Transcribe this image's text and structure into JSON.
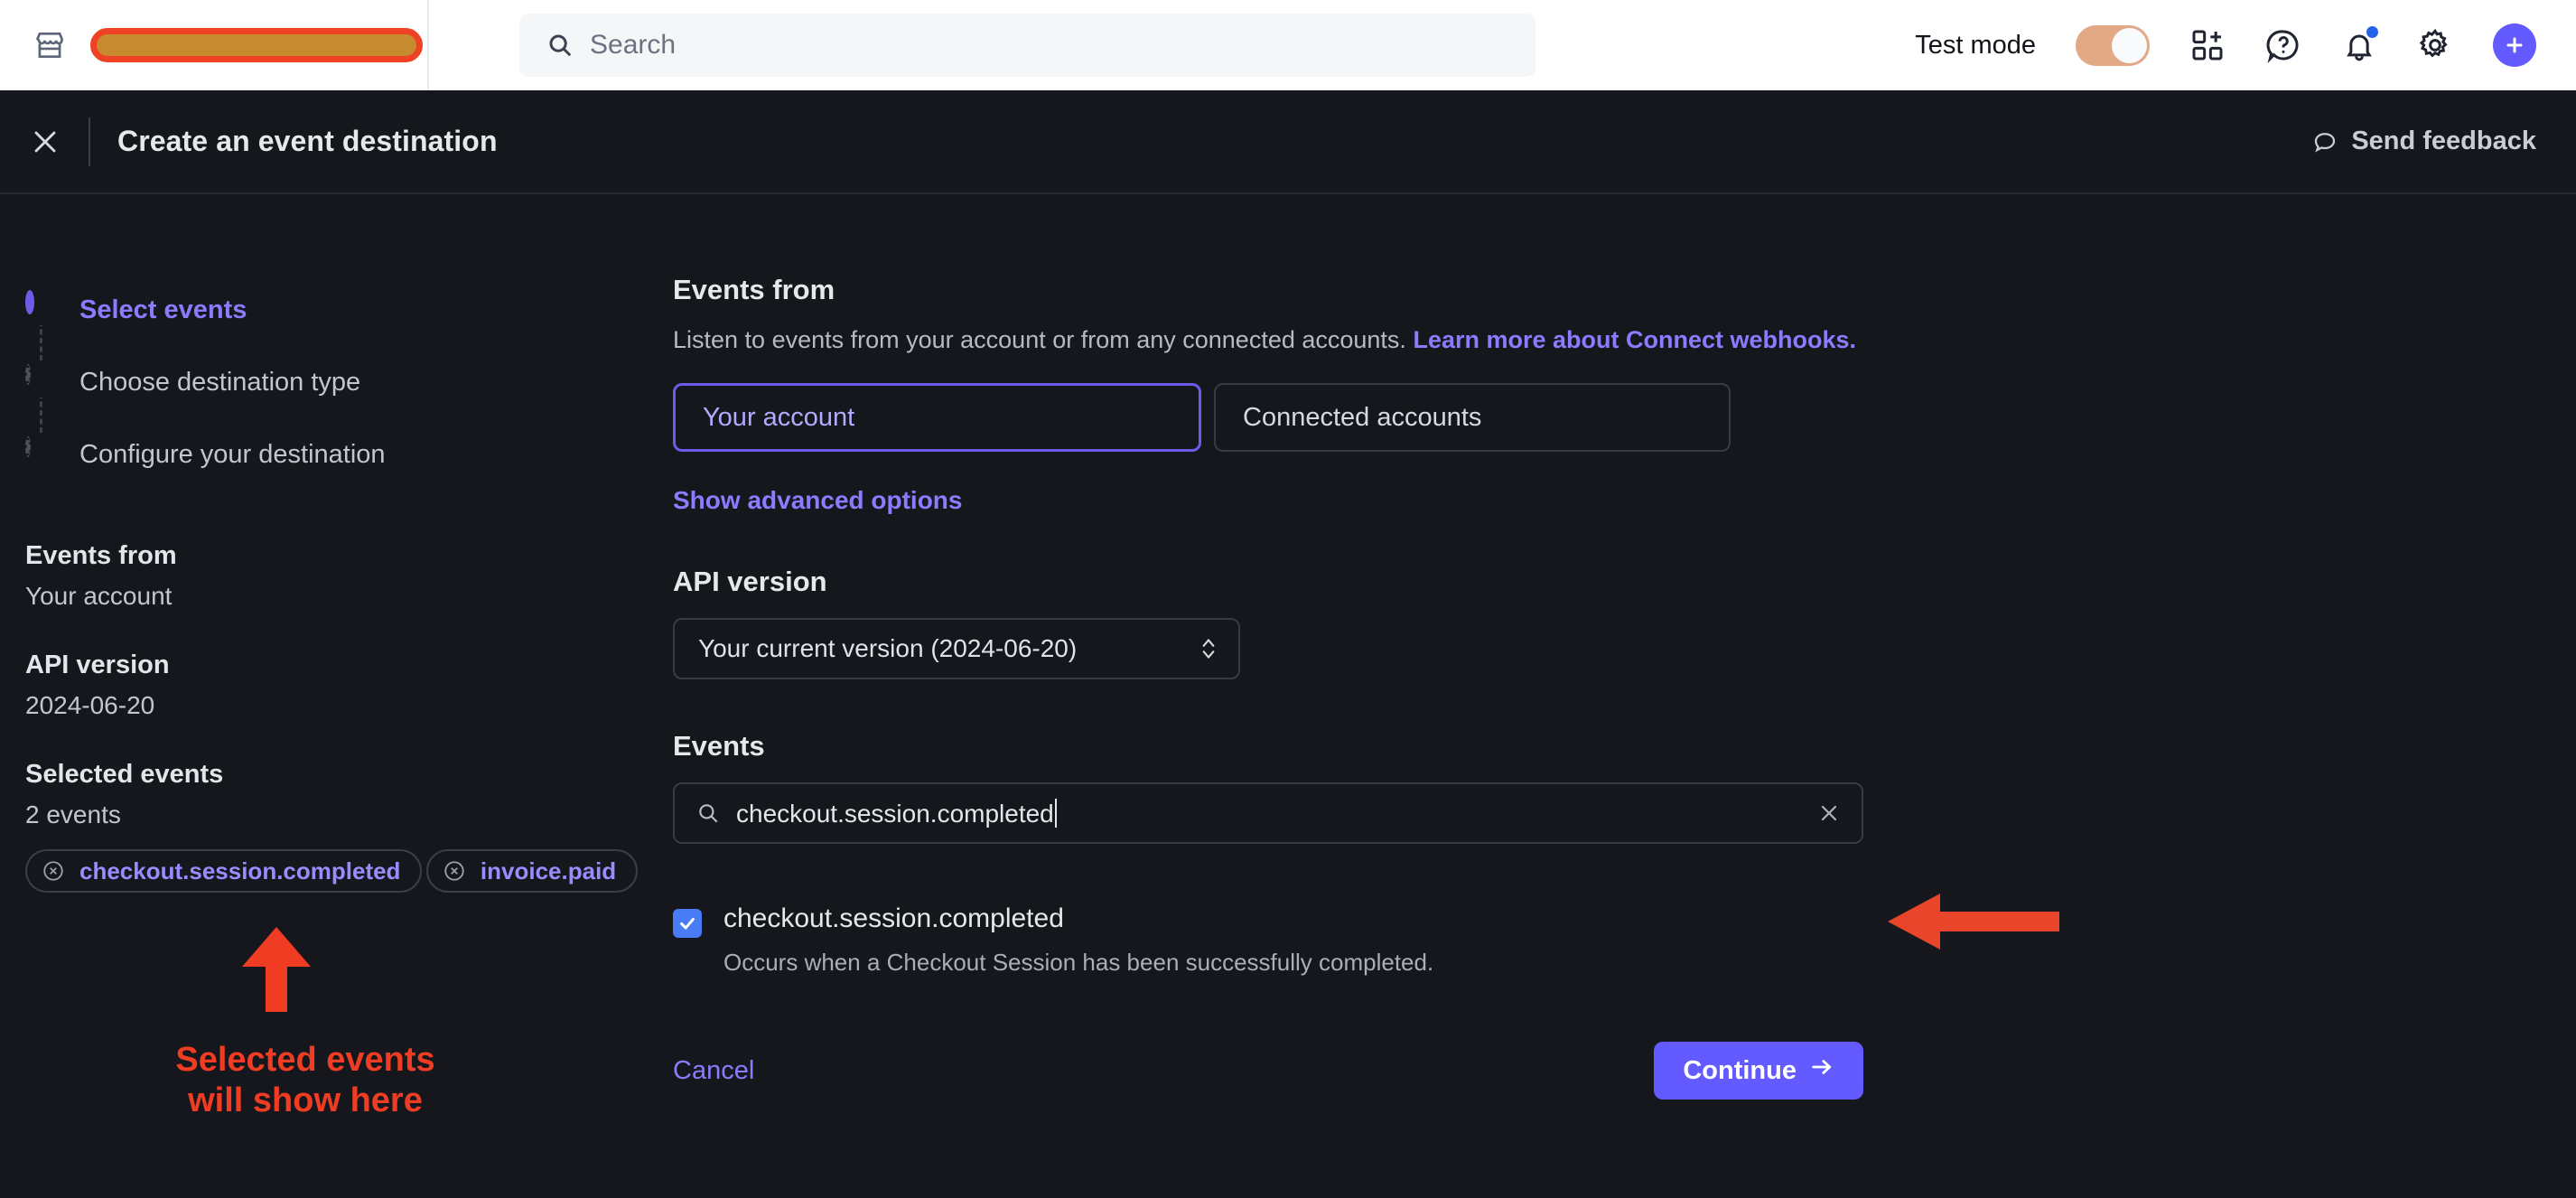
{
  "appbar": {
    "store_icon": "store-icon",
    "account_name_redacted": "",
    "search": {
      "placeholder": "Search",
      "icon": "search-icon"
    },
    "test_mode_label": "Test mode",
    "test_mode_on": true,
    "icons": [
      "apps-add-icon",
      "help-circle-icon",
      "notifications-bell-icon",
      "settings-gear-icon",
      "create-plus-icon"
    ],
    "accent_color": "#635bff",
    "toggle_color": "#e3a987"
  },
  "panel": {
    "close_label": "×",
    "title": "Create an event destination",
    "send_feedback_label": "Send feedback"
  },
  "sidebar": {
    "steps": [
      {
        "label": "Select events",
        "state": "active"
      },
      {
        "label": "Choose destination type",
        "state": "pending"
      },
      {
        "label": "Configure your destination",
        "state": "pending"
      }
    ],
    "summary": [
      {
        "title": "Events from",
        "value": "Your account"
      },
      {
        "title": "API version",
        "value": "2024-06-20"
      },
      {
        "title": "Selected events",
        "value": "2 events"
      }
    ],
    "selected_events": [
      "checkout.session.completed",
      "invoice.paid"
    ],
    "annotation": "Selected events\nwill show here",
    "annotation_color": "#f03c23"
  },
  "main": {
    "events_from": {
      "title": "Events from",
      "description": "Listen to events from your account or from any connected accounts.",
      "link_text": "Learn more about Connect webhooks.",
      "options": [
        {
          "label": "Your account",
          "selected": true
        },
        {
          "label": "Connected accounts",
          "selected": false
        }
      ],
      "advanced_link": "Show advanced options"
    },
    "api_version": {
      "label": "API version",
      "selected": "Your current version (2024-06-20)"
    },
    "events": {
      "label": "Events",
      "search_value": "checkout.session.completed",
      "clear_icon": "close-icon",
      "results": [
        {
          "checked": true,
          "name": "checkout.session.completed",
          "description": "Occurs when a Checkout Session has been successfully completed."
        }
      ]
    },
    "actions": {
      "cancel_label": "Cancel",
      "continue_label": "Continue",
      "continue_arrow": "→"
    }
  }
}
